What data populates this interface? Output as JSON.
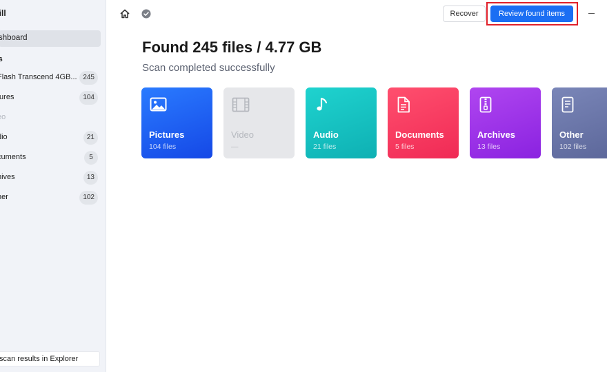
{
  "sidebar": {
    "app_title": "rill",
    "dashboard_label": "shboard",
    "section_label": "ts",
    "items": [
      {
        "label": "Flash Transcend 4GB...",
        "count": "245",
        "muted": false
      },
      {
        "label": "tures",
        "count": "104",
        "muted": false
      },
      {
        "label": "eo",
        "count": "",
        "muted": true
      },
      {
        "label": "dio",
        "count": "21",
        "muted": false
      },
      {
        "label": "cuments",
        "count": "5",
        "muted": false
      },
      {
        "label": "hives",
        "count": "13",
        "muted": false
      },
      {
        "label": "her",
        "count": "102",
        "muted": false
      }
    ],
    "footer_link": "scan results in Explorer"
  },
  "toolbar": {
    "recover_label": "Recover",
    "review_label": "Review found items",
    "icons": [
      "home-icon",
      "check-circle-icon",
      "minimize-icon"
    ]
  },
  "main": {
    "headline": "Found 245 files / 4.77 GB",
    "subline": "Scan completed successfully"
  },
  "cards": [
    {
      "name": "Pictures",
      "files": "104 files",
      "icon": "image-icon",
      "color": "#1a5df0"
    },
    {
      "name": "Video",
      "files": "—",
      "icon": "film-icon",
      "color": "#e6e7ea"
    },
    {
      "name": "Audio",
      "files": "21 files",
      "icon": "music-note-icon",
      "color": "#14c1c0"
    },
    {
      "name": "Documents",
      "files": "5 files",
      "icon": "document-icon",
      "color": "#f7365f"
    },
    {
      "name": "Archives",
      "files": "13 files",
      "icon": "archive-icon",
      "color": "#9b34e8"
    },
    {
      "name": "Other",
      "files": "102 files",
      "icon": "file-icon",
      "color": "#6874a8"
    }
  ],
  "colors": {
    "accent": "#1b6ef3",
    "highlight": "#e0202a"
  }
}
